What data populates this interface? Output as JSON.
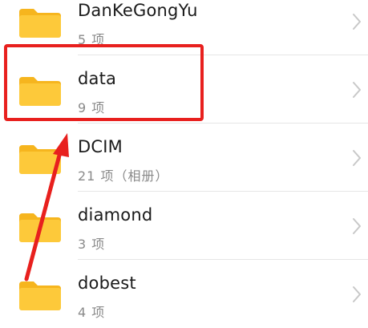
{
  "folders": [
    {
      "name": "DanKeGongYu",
      "meta": "5 项"
    },
    {
      "name": "data",
      "meta": "9 项"
    },
    {
      "name": "DCIM",
      "meta": "21 项（相册）"
    },
    {
      "name": "diamond",
      "meta": "3 项"
    },
    {
      "name": "dobest",
      "meta": "4 项"
    }
  ],
  "icons": {
    "folder": "folder-icon",
    "chevron": "chevron-right-icon"
  },
  "colors": {
    "folder_body": "#FDC93A",
    "folder_tab": "#F6B51E",
    "annotation_red": "#E8201E",
    "text_primary": "#1A1A1A",
    "text_secondary": "#8A8A8A",
    "chevron": "#C8C8C8"
  }
}
